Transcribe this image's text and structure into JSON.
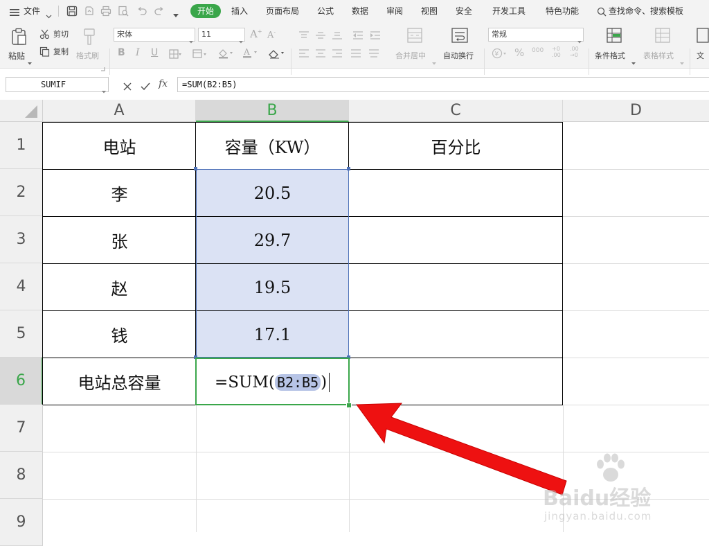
{
  "menubar": {
    "file": "文件",
    "tabs": [
      "开始",
      "插入",
      "页面布局",
      "公式",
      "数据",
      "审阅",
      "视图",
      "安全",
      "开发工具",
      "特色功能"
    ],
    "search": "查找命令、搜索模板"
  },
  "ribbon": {
    "paste": "粘贴",
    "cut": "剪切",
    "copy": "复制",
    "format_painter": "格式刷",
    "font_name": "宋体",
    "font_size": "11",
    "merge_center": "合并居中",
    "wrap_text": "自动换行",
    "number_format": "常规",
    "percent": "%",
    "cond_format": "条件格式",
    "table_style": "表格样式",
    "doc_partial": "文"
  },
  "formulabar": {
    "namebox": "SUMIF",
    "fx": "fx",
    "formula": "=SUM(B2:B5)"
  },
  "sheet": {
    "columns": [
      "A",
      "B",
      "C",
      "D"
    ],
    "rows": [
      "1",
      "2",
      "3",
      "4",
      "5",
      "6",
      "7",
      "8",
      "9"
    ],
    "header": {
      "a": "电站",
      "b": "容量（KW）",
      "c": "百分比"
    },
    "data": [
      {
        "a": "李",
        "b": "20.5"
      },
      {
        "a": "张",
        "b": "29.7"
      },
      {
        "a": "赵",
        "b": "19.5"
      },
      {
        "a": "钱",
        "b": "17.1"
      }
    ],
    "total_label": "电站总容量",
    "edit_formula_prefix": "=SUM(",
    "edit_formula_ref": "B2:B5",
    "edit_formula_suffix": ")"
  },
  "watermark": {
    "brand": "Baidu经验",
    "url": "jingyan.baidu.com"
  },
  "colors": {
    "accent_green": "#3aa64a",
    "selection_fill": "#dbe2f4",
    "selection_border": "#4f72b8",
    "active_cell_border": "#3aa64a",
    "arrow": "#ee1111"
  }
}
